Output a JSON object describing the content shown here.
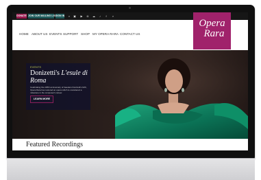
{
  "topbar": {
    "buttons": [
      "DONATE",
      "JOIN OUR MAILING LIST",
      "SIGN IN"
    ],
    "icons": [
      "search-icon",
      "cart-icon",
      "youtube-icon",
      "instagram-icon",
      "soundcloud-icon",
      "twitter-icon",
      "facebook-icon",
      "search-icon"
    ]
  },
  "nav": {
    "items": [
      "HOME",
      "ABOUT US",
      "EVENTS",
      "SUPPORT",
      "SHOP",
      "MY OPERA RARA",
      "CONTACT US"
    ]
  },
  "logo": {
    "line1": "Opera",
    "line2": "Rara"
  },
  "hero": {
    "label": "EVENTS",
    "title_prefix": "Donizetti's ",
    "title_em": "L'esule di Roma",
    "description": "Celebrating the 225th anniversary of Gaetano Donizetti's birth, Opera Rara has restored an opera which is considered a milestone in the composer's career.",
    "cta": "LEARN MORE"
  },
  "featured": {
    "title": "Featured Recordings"
  },
  "colors": {
    "accent": "#a0226b",
    "event_label": "#b6c04e",
    "overlay": "#141228"
  }
}
